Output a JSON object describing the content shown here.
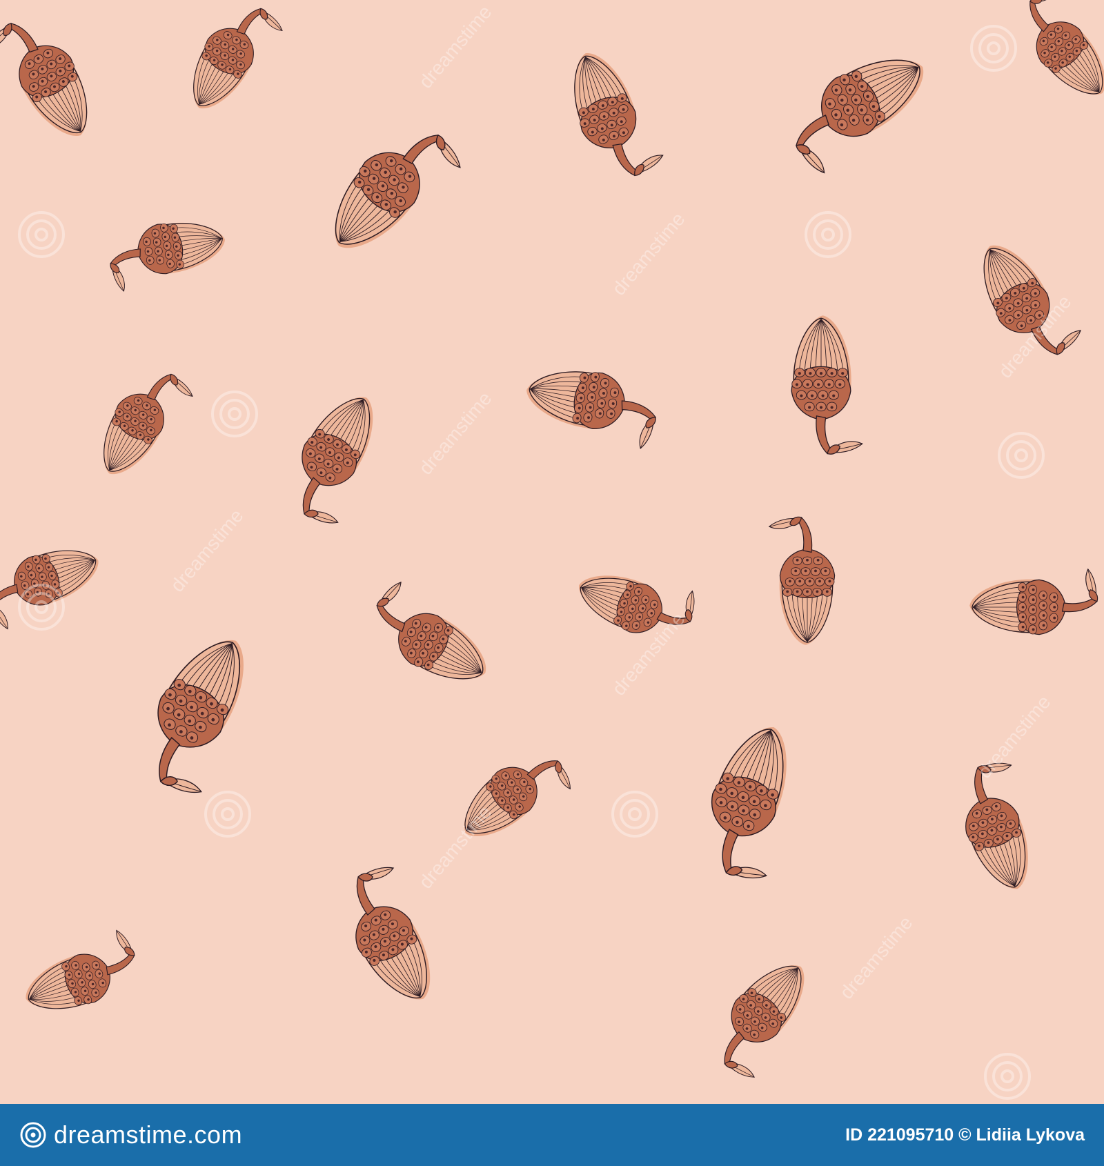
{
  "pattern": {
    "background_color": "#f7d3c3",
    "acorn_body_color": "#eeb79b",
    "acorn_cap_color": "#b9674b",
    "outline_color": "#2b1a22",
    "watermark_text": "dreamstime"
  },
  "footer": {
    "background_color": "#1a6eaa",
    "logo_text": "dreamstime.com",
    "image_id": "ID 221095710",
    "credit": "© Lidiia Lykova"
  }
}
